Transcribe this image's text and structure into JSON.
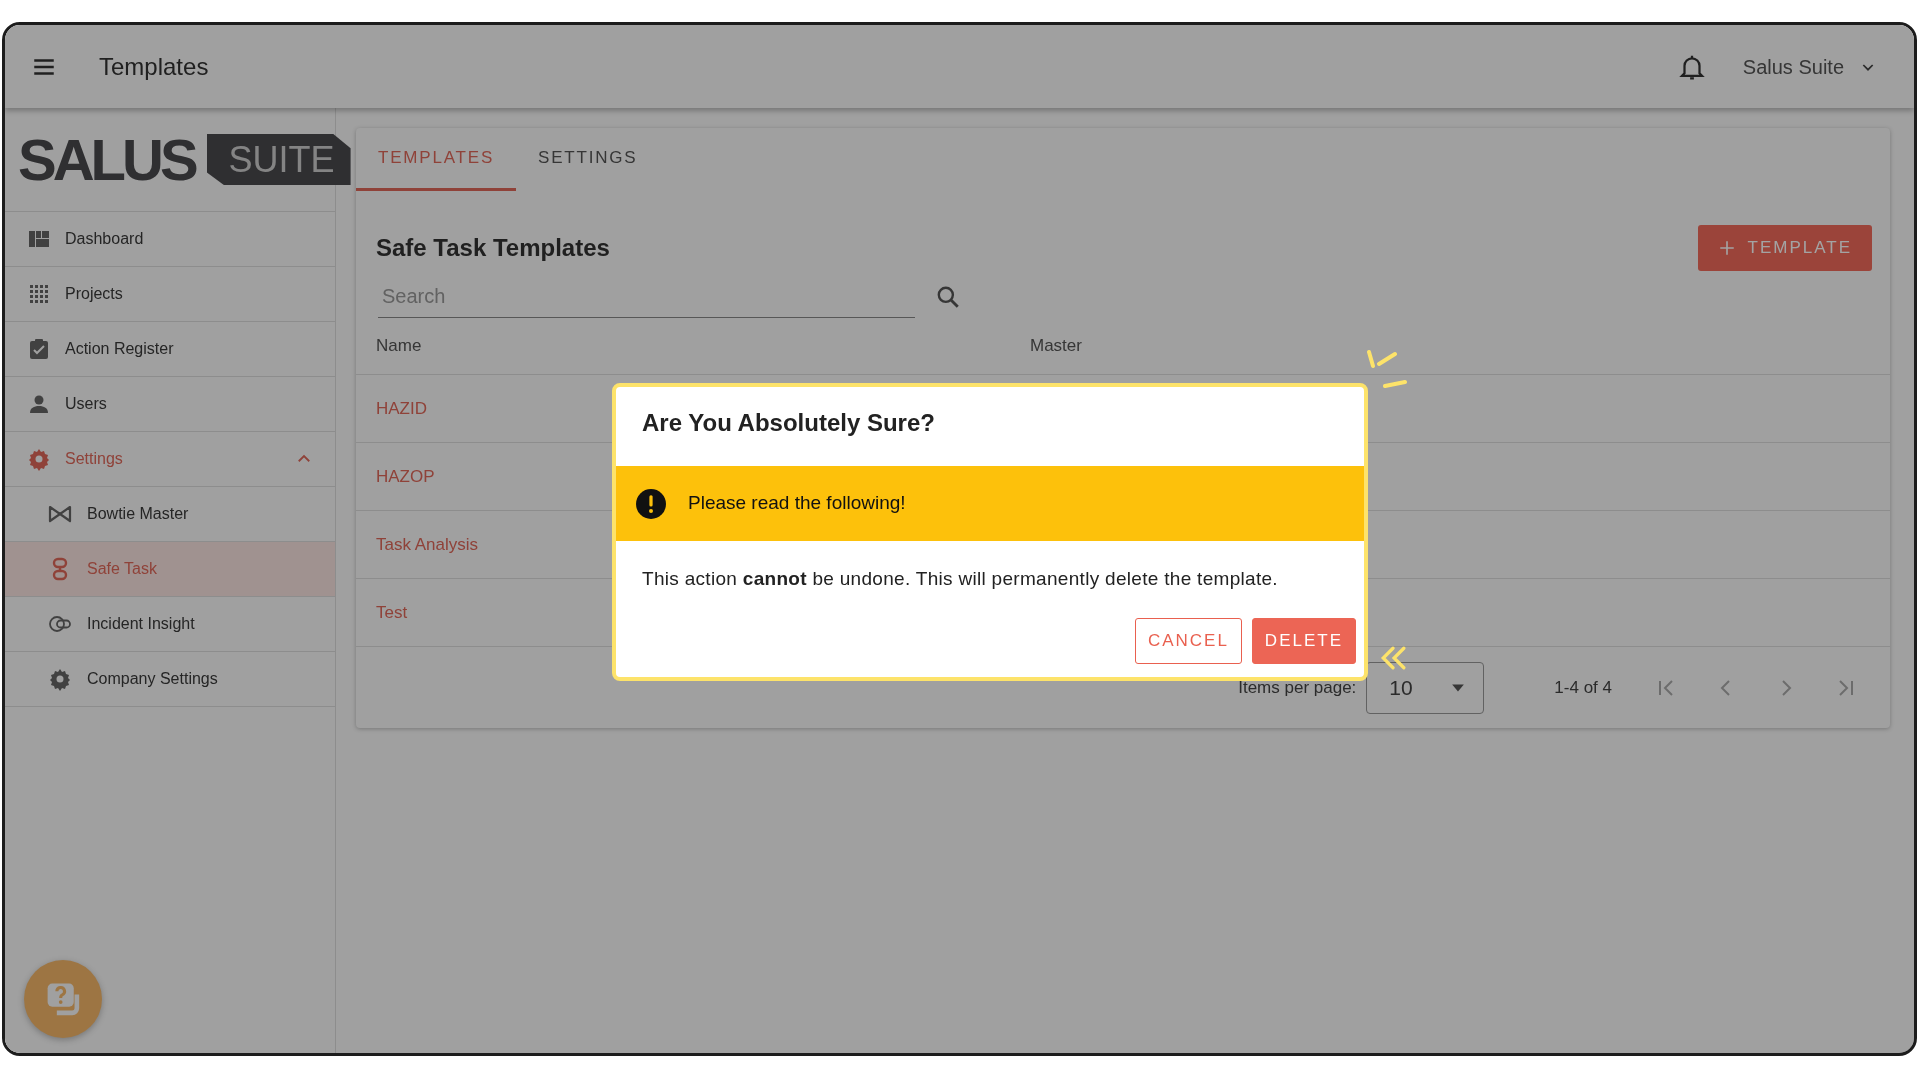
{
  "app_bar": {
    "title": "Templates",
    "user": "Salus Suite"
  },
  "logo": {
    "word": "SALUS",
    "badge": "SUITE"
  },
  "sidebar": {
    "items": [
      {
        "label": "Dashboard",
        "selected": false
      },
      {
        "label": "Projects",
        "selected": false
      },
      {
        "label": "Action Register",
        "selected": false
      },
      {
        "label": "Users",
        "selected": false
      },
      {
        "label": "Settings",
        "selected": true,
        "expanded": true,
        "children": [
          {
            "label": "Bowtie Master",
            "selected": false
          },
          {
            "label": "Safe Task",
            "selected": true
          },
          {
            "label": "Incident Insight",
            "selected": false
          },
          {
            "label": "Company Settings",
            "selected": false
          }
        ]
      }
    ]
  },
  "tabs": [
    {
      "label": "TEMPLATES",
      "selected": true
    },
    {
      "label": "SETTINGS",
      "selected": false
    }
  ],
  "heading": "Safe Task Templates",
  "add_button": "TEMPLATE",
  "search": {
    "placeholder": "Search"
  },
  "table": {
    "columns": [
      "Name",
      "Master"
    ],
    "rows": [
      {
        "name": "HAZID"
      },
      {
        "name": "HAZOP"
      },
      {
        "name": "Task Analysis"
      },
      {
        "name": "Test"
      }
    ]
  },
  "pagination": {
    "label": "Items per page:",
    "page_size": "10",
    "range": "1-4 of 4"
  },
  "dialog": {
    "title": "Are You Absolutely Sure?",
    "warning": "Please read the following!",
    "message": "This action **cannot** be undone. This will permanently delete the template.",
    "buttons": [
      {
        "label": "CANCEL",
        "kind": "outline"
      },
      {
        "label": "DELETE",
        "kind": "filled"
      }
    ]
  }
}
